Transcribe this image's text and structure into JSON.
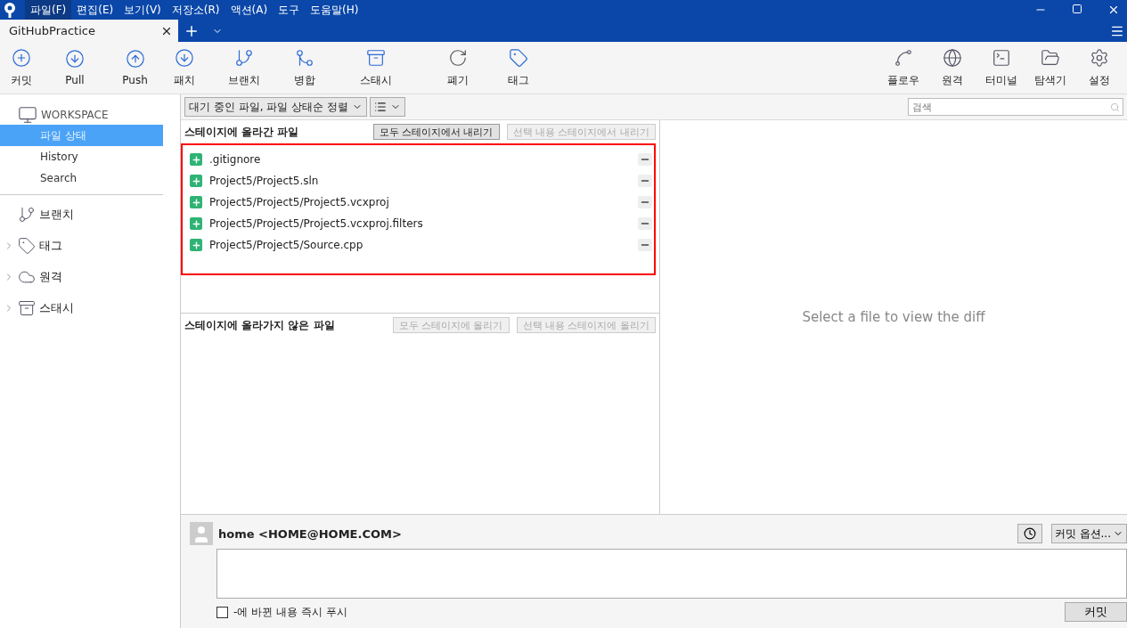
{
  "menu": [
    {
      "label": "파일(F)",
      "highlighted": true
    },
    {
      "label": "편집(E)",
      "highlighted": false
    },
    {
      "label": "보기(V)",
      "highlighted": false
    },
    {
      "label": "저장소(R)",
      "highlighted": false
    },
    {
      "label": "액션(A)",
      "highlighted": false
    },
    {
      "label": "도구",
      "highlighted": false
    },
    {
      "label": "도움말(H)",
      "highlighted": false
    }
  ],
  "tabs": [
    {
      "label": "GitHubPractice",
      "selected": true
    }
  ],
  "toolbar_left": [
    {
      "label": "커밋"
    },
    {
      "label": "Pull"
    },
    {
      "label": "Push"
    },
    {
      "label": "패치"
    },
    {
      "label": "브랜치"
    },
    {
      "label": "병합"
    },
    {
      "label": "스태시"
    },
    {
      "label": "폐기"
    },
    {
      "label": "태그"
    }
  ],
  "toolbar_right": [
    {
      "label": "플로우"
    },
    {
      "label": "원격"
    },
    {
      "label": "터미널"
    },
    {
      "label": "탐색기"
    },
    {
      "label": "설정"
    }
  ],
  "sidebar": {
    "workspace": "WORKSPACE",
    "items": [
      {
        "label": "파일 상태",
        "selected": true
      },
      {
        "label": "History",
        "selected": false
      },
      {
        "label": "Search",
        "selected": false
      }
    ],
    "sections": [
      {
        "label": "브랜치",
        "expandable": false
      },
      {
        "label": "태그",
        "expandable": true
      },
      {
        "label": "원격",
        "expandable": true
      },
      {
        "label": "스태시",
        "expandable": true
      }
    ]
  },
  "filter": {
    "sort": "대기 중인 파일, 파일 상태순 정렬",
    "search_placeholder": "검색"
  },
  "staged": {
    "title": "스테이지에 올라간 파일",
    "buttons": [
      {
        "label": "모두 스테이지에서 내리기",
        "disabled": false
      },
      {
        "label": "선택 내용 스테이지에서 내리기",
        "disabled": true
      }
    ],
    "files": [
      {
        "path": ".gitignore"
      },
      {
        "path": "Project5/Project5.sln"
      },
      {
        "path": "Project5/Project5/Project5.vcxproj"
      },
      {
        "path": "Project5/Project5/Project5.vcxproj.filters"
      },
      {
        "path": "Project5/Project5/Source.cpp"
      }
    ]
  },
  "unstaged": {
    "title": "스테이지에 올라가지 않은 파일",
    "buttons": [
      {
        "label": "모두 스테이지에 올리기",
        "disabled": true
      },
      {
        "label": "선택 내용 스테이지에 올리기",
        "disabled": true
      }
    ]
  },
  "diff": {
    "message": "Select a file to view the diff"
  },
  "commit": {
    "author": "home <HOME@HOME.COM>",
    "options": "커밋 옵션...",
    "push_label": "-에 바뀐 내용 즉시 푸시",
    "push_checked": false,
    "button": "커밋"
  }
}
